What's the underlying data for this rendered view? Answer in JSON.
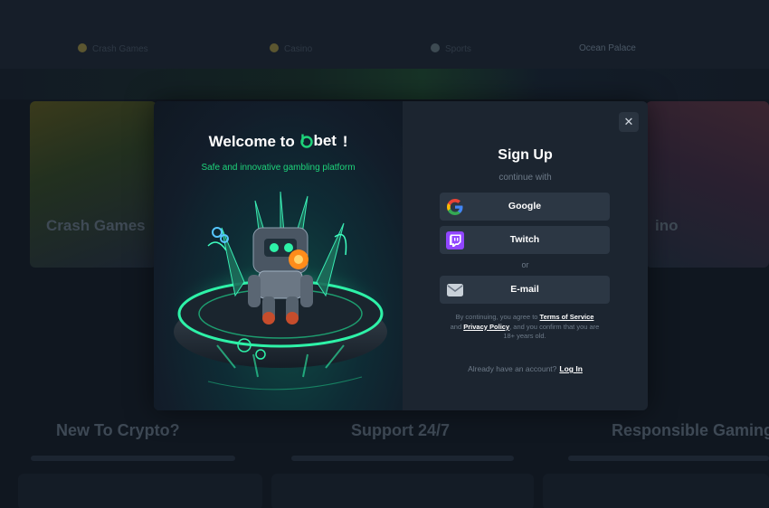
{
  "background": {
    "nav_items": [
      {
        "label": "Crash Games"
      },
      {
        "label": "Casino"
      },
      {
        "label": "Sports"
      },
      {
        "label": "Ocean Palace"
      }
    ],
    "cards": {
      "left_title": "Crash Games",
      "right_title": "ino"
    },
    "sections": [
      {
        "title": "New To Crypto?"
      },
      {
        "title": "Support 24/7"
      },
      {
        "title": "Responsible Gaming"
      }
    ]
  },
  "modal": {
    "welcome_prefix": "Welcome to",
    "brand_name": "bet",
    "welcome_suffix": "!",
    "tagline": "Safe and innovative gambling platform",
    "close_glyph": "✕",
    "signup_title": "Sign Up",
    "continue_with": "continue with",
    "buttons": {
      "google": "Google",
      "twitch": "Twitch",
      "email": "E-mail"
    },
    "or_text": "or",
    "terms": {
      "part1": "By continuing, you agree to ",
      "terms_link": "Terms of Service",
      "part2": " and ",
      "privacy_link": "Privacy Policy",
      "part3": ", and you confirm that you are 18+ years old."
    },
    "login": {
      "prompt": "Already have an account?",
      "link": "Log In"
    }
  },
  "colors": {
    "accent_green": "#1ed37a",
    "modal_bg": "#1c2530",
    "button_bg": "#2c3744",
    "page_bg": "#101720"
  },
  "icons": [
    "close-icon",
    "google-icon",
    "twitch-icon",
    "email-icon",
    "brand-logo-icon"
  ]
}
